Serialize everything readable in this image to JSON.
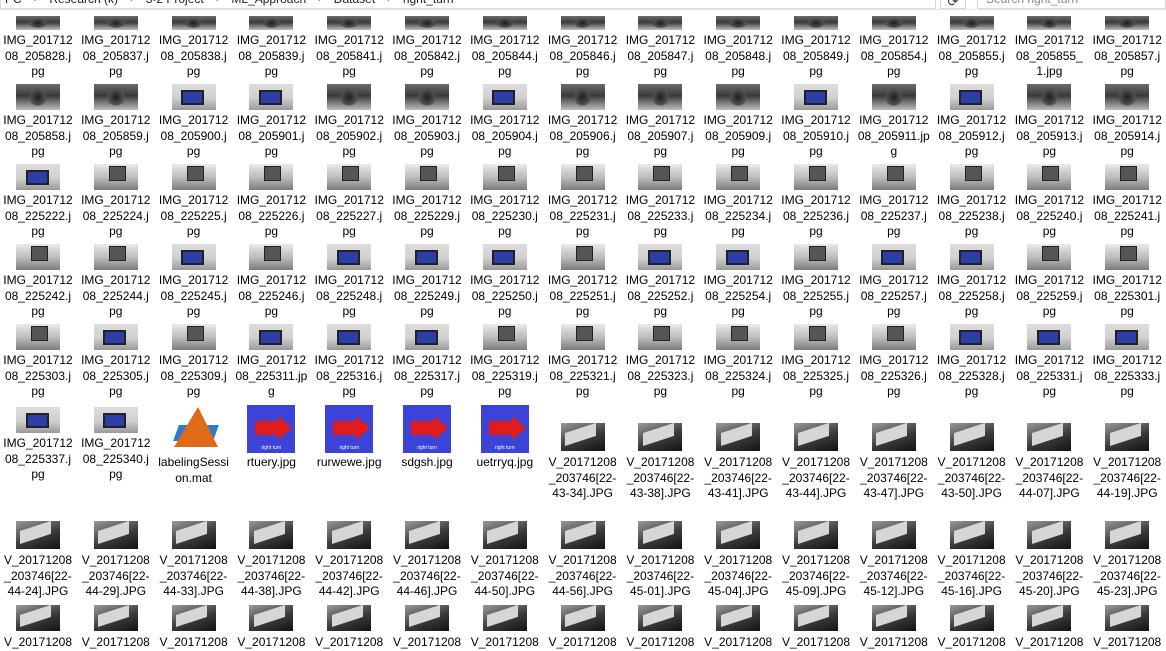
{
  "address_bar": {
    "crumbs": [
      "PC",
      "Research (k)",
      "3-2 Project",
      "ML_Approach",
      "Dataset",
      "right_turn"
    ],
    "search_placeholder": "Search right_turn"
  },
  "rows": [
    {
      "items": [
        {
          "name": "IMG_20171208_205828.jpg",
          "thumb": "gray"
        },
        {
          "name": "IMG_20171208_205837.jpg",
          "thumb": "gray"
        },
        {
          "name": "IMG_20171208_205838.jpg",
          "thumb": "gray"
        },
        {
          "name": "IMG_20171208_205839.jpg",
          "thumb": "gray"
        },
        {
          "name": "IMG_20171208_205841.jpg",
          "thumb": "gray"
        },
        {
          "name": "IMG_20171208_205842.jpg",
          "thumb": "gray"
        },
        {
          "name": "IMG_20171208_205844.jpg",
          "thumb": "gray"
        },
        {
          "name": "IMG_20171208_205846.jpg",
          "thumb": "gray"
        },
        {
          "name": "IMG_20171208_205847.jpg",
          "thumb": "gray"
        },
        {
          "name": "IMG_20171208_205848.jpg",
          "thumb": "gray"
        },
        {
          "name": "IMG_20171208_205849.jpg",
          "thumb": "gray"
        },
        {
          "name": "IMG_20171208_205854.jpg",
          "thumb": "gray"
        },
        {
          "name": "IMG_20171208_205855.jpg",
          "thumb": "gray"
        },
        {
          "name": "IMG_20171208_205855_1.jpg",
          "thumb": "gray"
        },
        {
          "name": "IMG_20171208_205857.jpg",
          "thumb": "gray"
        }
      ]
    },
    {
      "items": [
        {
          "name": "IMG_20171208_205858.jpg",
          "thumb": "gray"
        },
        {
          "name": "IMG_20171208_205859.jpg",
          "thumb": "gray"
        },
        {
          "name": "IMG_20171208_205900.jpg",
          "thumb": "box"
        },
        {
          "name": "IMG_20171208_205901.jpg",
          "thumb": "box"
        },
        {
          "name": "IMG_20171208_205902.jpg",
          "thumb": "gray"
        },
        {
          "name": "IMG_20171208_205903.jpg",
          "thumb": "gray"
        },
        {
          "name": "IMG_20171208_205904.jpg",
          "thumb": "box"
        },
        {
          "name": "IMG_20171208_205906.jpg",
          "thumb": "gray"
        },
        {
          "name": "IMG_20171208_205907.jpg",
          "thumb": "gray"
        },
        {
          "name": "IMG_20171208_205909.jpg",
          "thumb": "gray"
        },
        {
          "name": "IMG_20171208_205910.jpg",
          "thumb": "box"
        },
        {
          "name": "IMG_20171208_205911.jpg",
          "thumb": "gray"
        },
        {
          "name": "IMG_20171208_205912.jpg",
          "thumb": "box"
        },
        {
          "name": "IMG_20171208_205913.jpg",
          "thumb": "gray"
        },
        {
          "name": "IMG_20171208_205914.jpg",
          "thumb": "gray"
        }
      ]
    },
    {
      "items": [
        {
          "name": "IMG_20171208_225222.jpg",
          "thumb": "box"
        },
        {
          "name": "IMG_20171208_225224.jpg",
          "thumb": "floor"
        },
        {
          "name": "IMG_20171208_225225.jpg",
          "thumb": "floor"
        },
        {
          "name": "IMG_20171208_225226.jpg",
          "thumb": "floor"
        },
        {
          "name": "IMG_20171208_225227.jpg",
          "thumb": "floor"
        },
        {
          "name": "IMG_20171208_225229.jpg",
          "thumb": "floor"
        },
        {
          "name": "IMG_20171208_225230.jpg",
          "thumb": "floor"
        },
        {
          "name": "IMG_20171208_225231.jpg",
          "thumb": "floor"
        },
        {
          "name": "IMG_20171208_225233.jpg",
          "thumb": "floor"
        },
        {
          "name": "IMG_20171208_225234.jpg",
          "thumb": "floor"
        },
        {
          "name": "IMG_20171208_225236.jpg",
          "thumb": "floor"
        },
        {
          "name": "IMG_20171208_225237.jpg",
          "thumb": "floor"
        },
        {
          "name": "IMG_20171208_225238.jpg",
          "thumb": "floor"
        },
        {
          "name": "IMG_20171208_225240.jpg",
          "thumb": "floor"
        },
        {
          "name": "IMG_20171208_225241.jpg",
          "thumb": "floor"
        }
      ]
    },
    {
      "items": [
        {
          "name": "IMG_20171208_225242.jpg",
          "thumb": "floor"
        },
        {
          "name": "IMG_20171208_225244.jpg",
          "thumb": "floor"
        },
        {
          "name": "IMG_20171208_225245.jpg",
          "thumb": "box"
        },
        {
          "name": "IMG_20171208_225246.jpg",
          "thumb": "floor"
        },
        {
          "name": "IMG_20171208_225248.jpg",
          "thumb": "box"
        },
        {
          "name": "IMG_20171208_225249.jpg",
          "thumb": "box"
        },
        {
          "name": "IMG_20171208_225250.jpg",
          "thumb": "box"
        },
        {
          "name": "IMG_20171208_225251.jpg",
          "thumb": "floor"
        },
        {
          "name": "IMG_20171208_225252.jpg",
          "thumb": "box"
        },
        {
          "name": "IMG_20171208_225254.jpg",
          "thumb": "box"
        },
        {
          "name": "IMG_20171208_225255.jpg",
          "thumb": "floor"
        },
        {
          "name": "IMG_20171208_225257.jpg",
          "thumb": "box"
        },
        {
          "name": "IMG_20171208_225258.jpg",
          "thumb": "box"
        },
        {
          "name": "IMG_20171208_225259.jpg",
          "thumb": "floor"
        },
        {
          "name": "IMG_20171208_225301.jpg",
          "thumb": "floor"
        }
      ]
    },
    {
      "items": [
        {
          "name": "IMG_20171208_225303.jpg",
          "thumb": "floor"
        },
        {
          "name": "IMG_20171208_225305.jpg",
          "thumb": "box"
        },
        {
          "name": "IMG_20171208_225309.jpg",
          "thumb": "floor"
        },
        {
          "name": "IMG_20171208_225311.jpg",
          "thumb": "box"
        },
        {
          "name": "IMG_20171208_225316.jpg",
          "thumb": "box"
        },
        {
          "name": "IMG_20171208_225317.jpg",
          "thumb": "box"
        },
        {
          "name": "IMG_20171208_225319.jpg",
          "thumb": "floor"
        },
        {
          "name": "IMG_20171208_225321.jpg",
          "thumb": "floor"
        },
        {
          "name": "IMG_20171208_225323.jpg",
          "thumb": "floor"
        },
        {
          "name": "IMG_20171208_225324.jpg",
          "thumb": "floor"
        },
        {
          "name": "IMG_20171208_225325.jpg",
          "thumb": "floor"
        },
        {
          "name": "IMG_20171208_225326.jpg",
          "thumb": "floor"
        },
        {
          "name": "IMG_20171208_225328.jpg",
          "thumb": "box"
        },
        {
          "name": "IMG_20171208_225331.jpg",
          "thumb": "box"
        },
        {
          "name": "IMG_20171208_225333.jpg",
          "thumb": "box"
        }
      ]
    },
    {
      "items": [
        {
          "name": "IMG_20171208_225337.jpg",
          "thumb": "box"
        },
        {
          "name": "IMG_20171208_225340.jpg",
          "thumb": "box"
        },
        {
          "name": "labelingSession.mat",
          "thumb": "mat"
        },
        {
          "name": "rtuery.jpg",
          "thumb": "blue"
        },
        {
          "name": "rurwewe.jpg",
          "thumb": "blue"
        },
        {
          "name": "sdgsh.jpg",
          "thumb": "blue"
        },
        {
          "name": "uetrryq.jpg",
          "thumb": "blue"
        },
        {
          "name": "V_20171208_203746[22-43-34].JPG",
          "thumb": "video"
        },
        {
          "name": "V_20171208_203746[22-43-38].JPG",
          "thumb": "video"
        },
        {
          "name": "V_20171208_203746[22-43-41].JPG",
          "thumb": "video"
        },
        {
          "name": "V_20171208_203746[22-43-44].JPG",
          "thumb": "video"
        },
        {
          "name": "V_20171208_203746[22-43-47].JPG",
          "thumb": "video"
        },
        {
          "name": "V_20171208_203746[22-43-50].JPG",
          "thumb": "video"
        },
        {
          "name": "V_20171208_203746[22-44-07].JPG",
          "thumb": "video"
        },
        {
          "name": "V_20171208_203746[22-44-19].JPG",
          "thumb": "video"
        }
      ]
    },
    {
      "items": [
        {
          "name": "V_20171208_203746[22-44-24].JPG",
          "thumb": "video"
        },
        {
          "name": "V_20171208_203746[22-44-29].JPG",
          "thumb": "video"
        },
        {
          "name": "V_20171208_203746[22-44-33].JPG",
          "thumb": "video"
        },
        {
          "name": "V_20171208_203746[22-44-38].JPG",
          "thumb": "video"
        },
        {
          "name": "V_20171208_203746[22-44-42].JPG",
          "thumb": "video"
        },
        {
          "name": "V_20171208_203746[22-44-46].JPG",
          "thumb": "video"
        },
        {
          "name": "V_20171208_203746[22-44-50].JPG",
          "thumb": "video"
        },
        {
          "name": "V_20171208_203746[22-44-56].JPG",
          "thumb": "video"
        },
        {
          "name": "V_20171208_203746[22-45-01].JPG",
          "thumb": "video"
        },
        {
          "name": "V_20171208_203746[22-45-04].JPG",
          "thumb": "video"
        },
        {
          "name": "V_20171208_203746[22-45-09].JPG",
          "thumb": "video"
        },
        {
          "name": "V_20171208_203746[22-45-12].JPG",
          "thumb": "video"
        },
        {
          "name": "V_20171208_203746[22-45-16].JPG",
          "thumb": "video"
        },
        {
          "name": "V_20171208_203746[22-45-20].JPG",
          "thumb": "video"
        },
        {
          "name": "V_20171208_203746[22-45-23].JPG",
          "thumb": "video"
        }
      ]
    },
    {
      "items": [
        {
          "name": "V_20171208",
          "thumb": "video"
        },
        {
          "name": "V_20171208",
          "thumb": "video"
        },
        {
          "name": "V_20171208",
          "thumb": "video"
        },
        {
          "name": "V_20171208",
          "thumb": "video"
        },
        {
          "name": "V_20171208",
          "thumb": "video"
        },
        {
          "name": "V_20171208",
          "thumb": "video"
        },
        {
          "name": "V_20171208",
          "thumb": "video"
        },
        {
          "name": "V_20171208",
          "thumb": "video"
        },
        {
          "name": "V_20171208",
          "thumb": "video"
        },
        {
          "name": "V_20171208",
          "thumb": "video"
        },
        {
          "name": "V_20171208",
          "thumb": "video"
        },
        {
          "name": "V_20171208",
          "thumb": "video"
        },
        {
          "name": "V_20171208",
          "thumb": "video"
        },
        {
          "name": "V_20171208",
          "thumb": "video"
        },
        {
          "name": "V_20171208",
          "thumb": "video"
        }
      ]
    }
  ],
  "thumb_captions": {
    "rtuery.jpg": "right turn",
    "rurwewe.jpg": "right turn",
    "sdgsh.jpg": "right turn",
    "uetrryq.jpg": "right turn"
  },
  "refresh_icon": "refresh-icon"
}
